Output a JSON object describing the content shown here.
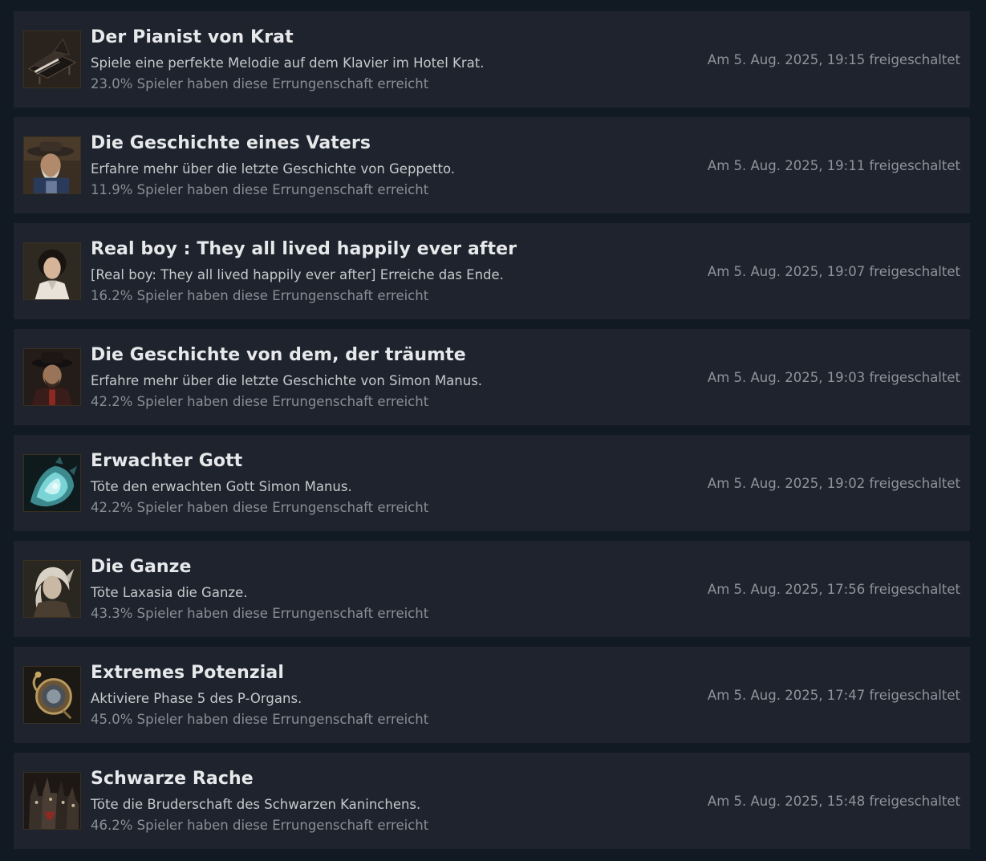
{
  "achievements": [
    {
      "title": "Der Pianist von Krat",
      "description": "Spiele eine perfekte Melodie auf dem Klavier im Hotel Krat.",
      "percent_text": "23.0% Spieler haben diese Errungenschaft erreicht",
      "unlocked_text": "Am 5. Aug. 2025, 19:15 freigeschaltet",
      "icon": "piano-icon"
    },
    {
      "title": "Die Geschichte eines Vaters",
      "description": "Erfahre mehr über die letzte Geschichte von Geppetto.",
      "percent_text": "11.9% Spieler haben diese Errungenschaft erreicht",
      "unlocked_text": "Am 5. Aug. 2025, 19:11 freigeschaltet",
      "icon": "old-man-portrait-icon"
    },
    {
      "title": "Real boy : They all lived happily ever after",
      "description": "[Real boy: They all lived happily ever after] Erreiche das Ende.",
      "percent_text": "16.2% Spieler haben diese Errungenschaft erreicht",
      "unlocked_text": "Am 5. Aug. 2025, 19:07 freigeschaltet",
      "icon": "boy-portrait-icon"
    },
    {
      "title": "Die Geschichte von dem, der träumte",
      "description": "Erfahre mehr über die letzte Geschichte von Simon Manus.",
      "percent_text": "42.2% Spieler haben diese Errungenschaft erreicht",
      "unlocked_text": "Am 5. Aug. 2025, 19:03 freigeschaltet",
      "icon": "man-in-hat-portrait-icon"
    },
    {
      "title": "Erwachter Gott",
      "description": "Töte den erwachten Gott Simon Manus.",
      "percent_text": "42.2% Spieler haben diese Errungenschaft erreicht",
      "unlocked_text": "Am 5. Aug. 2025, 19:02 freigeschaltet",
      "icon": "awakened-god-icon"
    },
    {
      "title": "Die Ganze",
      "description": "Töte Laxasia die Ganze.",
      "percent_text": "43.3% Spieler haben diese Errungenschaft erreicht",
      "unlocked_text": "Am 5. Aug. 2025, 17:56 freigeschaltet",
      "icon": "laxasia-portrait-icon"
    },
    {
      "title": "Extremes Potenzial",
      "description": "Aktiviere Phase 5 des P-Organs.",
      "percent_text": "45.0% Spieler haben diese Errungenschaft erreicht",
      "unlocked_text": "Am 5. Aug. 2025, 17:47 freigeschaltet",
      "icon": "p-organ-icon"
    },
    {
      "title": "Schwarze Rache",
      "description": "Töte die Bruderschaft des Schwarzen Kaninchens.",
      "percent_text": "46.2% Spieler haben diese Errungenschaft erreicht",
      "unlocked_text": "Am 5. Aug. 2025, 15:48 freigeschaltet",
      "icon": "black-rabbit-brotherhood-icon"
    }
  ]
}
